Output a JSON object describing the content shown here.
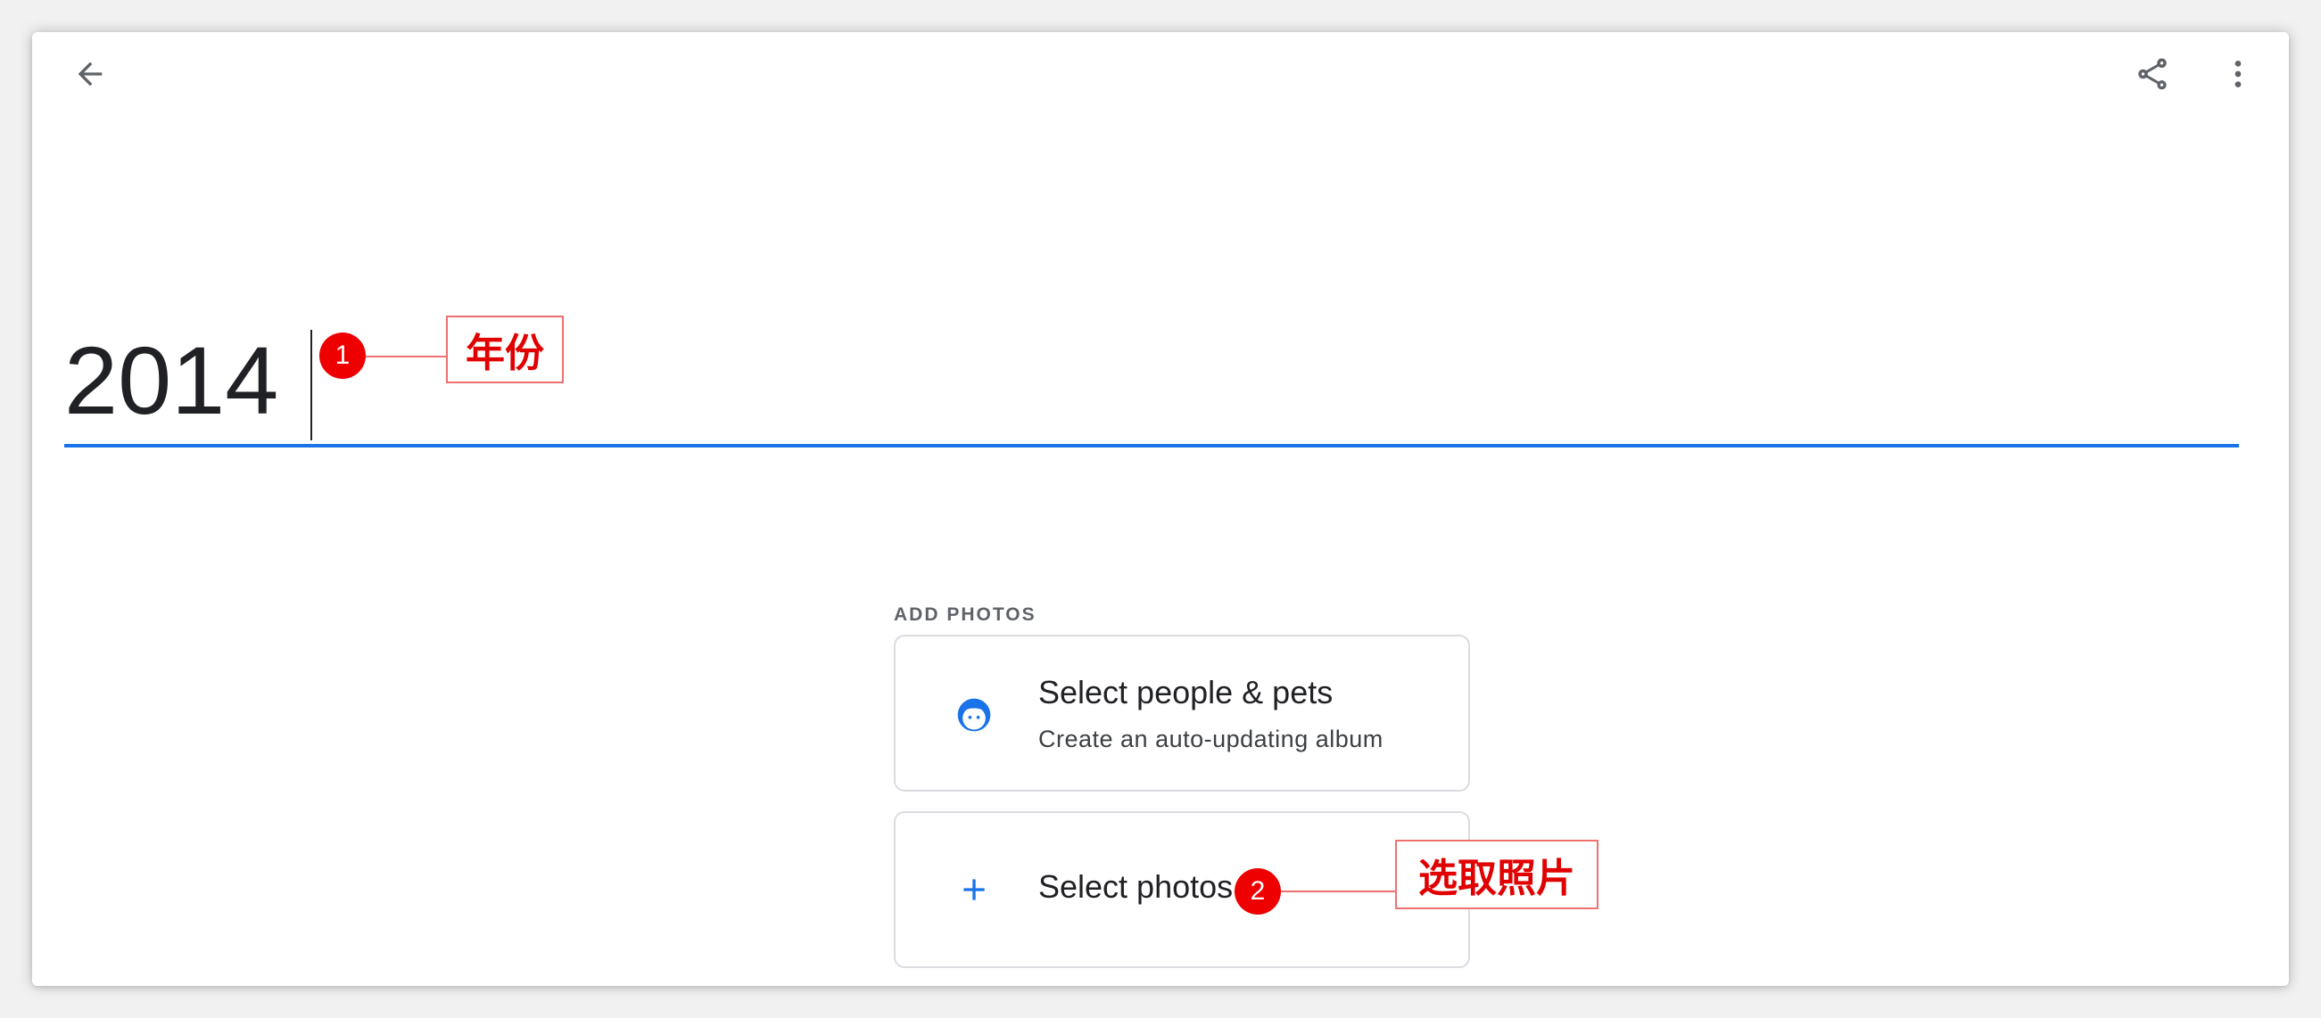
{
  "toolbar": {
    "back_icon": "arrow-back-icon",
    "share_icon": "share-icon",
    "more_icon": "more-vert-icon"
  },
  "album": {
    "title": "2014"
  },
  "add_photos": {
    "section_label": "ADD PHOTOS",
    "people_card": {
      "icon": "face-icon",
      "title": "Select people & pets",
      "subtitle": "Create an auto-updating album"
    },
    "photos_card": {
      "icon": "plus-icon",
      "title": "Select photos"
    }
  },
  "annotations": [
    {
      "number": "1",
      "label": "年份"
    },
    {
      "number": "2",
      "label": "选取照片"
    }
  ],
  "colors": {
    "accent": "#1a73e8",
    "annotation_red": "#ee0000",
    "text": "#202124"
  }
}
